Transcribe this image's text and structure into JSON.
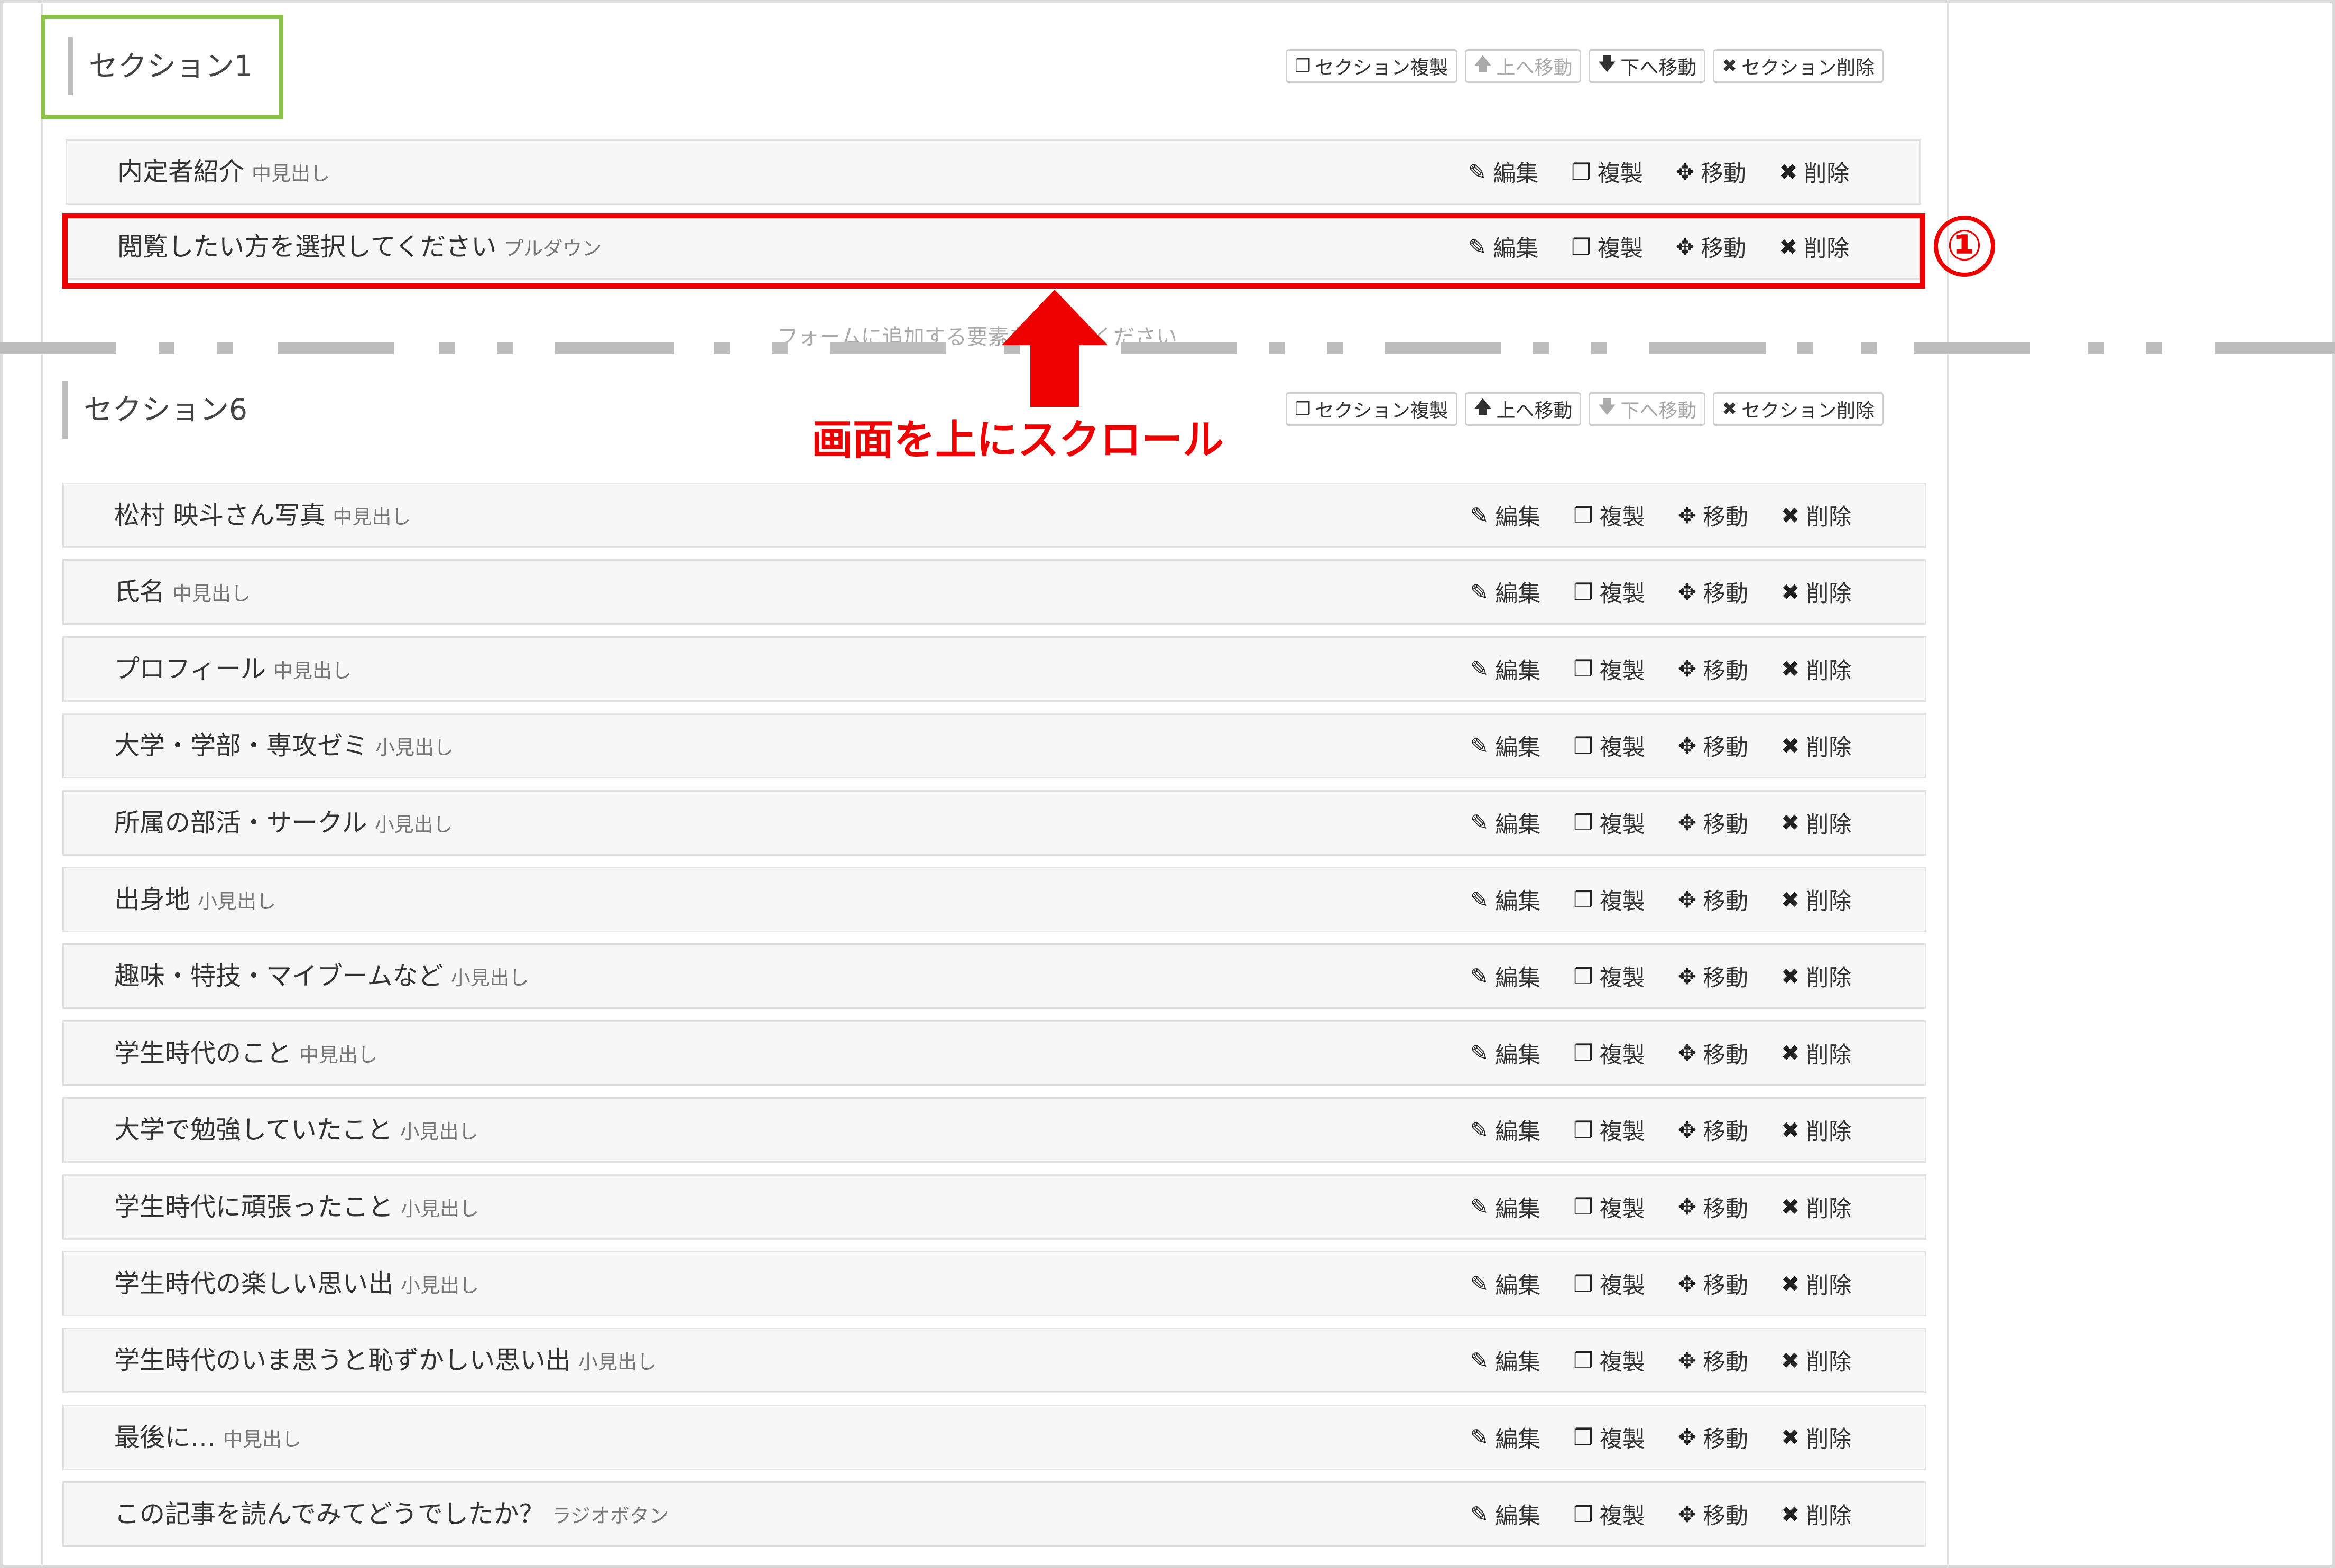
{
  "section1": {
    "title": "セクション1",
    "buttons": {
      "copy": "セクション複製",
      "up": "上へ移動",
      "down": "下へ移動",
      "delete": "セクション削除"
    }
  },
  "section6": {
    "title": "セクション6",
    "buttons": {
      "copy": "セクション複製",
      "up": "上へ移動",
      "down": "下へ移動",
      "delete": "セクション削除"
    }
  },
  "actions": {
    "edit": "編集",
    "copy": "複製",
    "move": "移動",
    "delete": "削除"
  },
  "section1_rows": [
    {
      "label": "内定者紹介",
      "type": "中見出し"
    },
    {
      "label": "閲覧したい方を選択してください",
      "type": "プルダウン"
    }
  ],
  "hint_text": "フォームに追加する要素を選んでください",
  "annotation": {
    "number": "①",
    "scroll_label": "画面を上にスクロール",
    "color": "#ee0000",
    "highlight_color": "#8bc34a"
  },
  "section6_rows": [
    {
      "label": "松村 映斗さん写真",
      "type": "中見出し"
    },
    {
      "label": "氏名",
      "type": "中見出し"
    },
    {
      "label": "プロフィール",
      "type": "中見出し"
    },
    {
      "label": "大学・学部・専攻ゼミ",
      "type": "小見出し"
    },
    {
      "label": "所属の部活・サークル",
      "type": "小見出し"
    },
    {
      "label": "出身地",
      "type": "小見出し"
    },
    {
      "label": "趣味・特技・マイブームなど",
      "type": "小見出し"
    },
    {
      "label": "学生時代のこと",
      "type": "中見出し"
    },
    {
      "label": "大学で勉強していたこと",
      "type": "小見出し"
    },
    {
      "label": "学生時代に頑張ったこと",
      "type": "小見出し"
    },
    {
      "label": "学生時代の楽しい思い出",
      "type": "小見出し"
    },
    {
      "label": "学生時代のいま思うと恥ずかしい思い出",
      "type": "小見出し"
    },
    {
      "label": "最後に…",
      "type": "中見出し"
    },
    {
      "label": "この記事を読んでみてどうでしたか？",
      "type": "ラジオボタン"
    }
  ]
}
